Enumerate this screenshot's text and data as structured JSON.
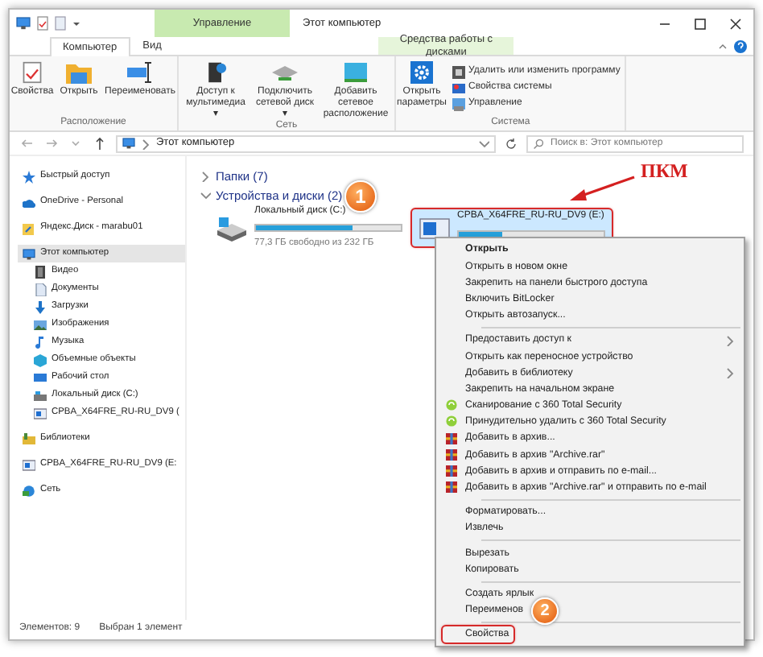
{
  "window": {
    "title": "Этот компьютер",
    "context_tab_header": "Управление"
  },
  "ribbon_tabs": [
    {
      "label": "Компьютер",
      "selected": true,
      "kind": "normal"
    },
    {
      "label": "Вид",
      "selected": false,
      "kind": "normal"
    },
    {
      "label": "Средства работы с дисками",
      "selected": false,
      "kind": "context"
    }
  ],
  "ribbon_groups": [
    {
      "label": "Расположение",
      "buttons": [
        {
          "label": "Свойства"
        },
        {
          "label": "Открыть"
        },
        {
          "label": "Переименовать"
        }
      ]
    },
    {
      "label": "Сеть",
      "buttons": [
        {
          "label": "Доступ к мультимедиа ▾"
        },
        {
          "label": "Подключить сетевой диск ▾"
        },
        {
          "label": "Добавить сетевое расположение"
        }
      ]
    },
    {
      "label": "Система",
      "buttons": [
        {
          "label": "Открыть параметры"
        }
      ],
      "small_buttons": [
        {
          "label": "Удалить или изменить программу"
        },
        {
          "label": "Свойства системы"
        },
        {
          "label": "Управление"
        }
      ]
    }
  ],
  "address_bar": {
    "path": "Этот компьютер",
    "search_placeholder": "Поиск в: Этот компьютер"
  },
  "sidebar": {
    "items": [
      {
        "label": "Быстрый доступ",
        "selected": false
      },
      {
        "label": "OneDrive - Personal",
        "selected": false
      },
      {
        "label": "Яндекс.Диск - marabu01",
        "selected": false
      },
      {
        "label": "Этот компьютер",
        "selected": true,
        "children": [
          {
            "label": "Видео",
            "selected": false
          },
          {
            "label": "Документы",
            "selected": false
          },
          {
            "label": "Загрузки",
            "selected": false
          },
          {
            "label": "Изображения",
            "selected": false
          },
          {
            "label": "Музыка",
            "selected": false
          },
          {
            "label": "Объемные объекты",
            "selected": false
          },
          {
            "label": "Рабочий стол",
            "selected": false
          },
          {
            "label": "Локальный диск (C:)",
            "selected": false
          },
          {
            "label": "CPBA_X64FRE_RU-RU_DV9 (",
            "selected": false
          }
        ]
      },
      {
        "label": "Библиотеки",
        "selected": false
      },
      {
        "label": "CPBA_X64FRE_RU-RU_DV9 (E:",
        "selected": false
      },
      {
        "label": "Сеть",
        "selected": false
      }
    ]
  },
  "content": {
    "groups": [
      {
        "label": "Папки (7)",
        "expanded": false
      },
      {
        "label": "Устройства и диски (2)",
        "expanded": true
      }
    ],
    "drives": [
      {
        "name": "Локальный диск (C:)",
        "free": "77,3 ГБ свободно из 232 ГБ",
        "level": 0.67,
        "selected": false,
        "marked": false
      },
      {
        "name": "CPBA_X64FRE_RU-RU_DV9 (E:)",
        "level": 0.3,
        "selected": true,
        "marked": true
      }
    ]
  },
  "context_menu": {
    "groups": [
      [
        {
          "label": "Открыть",
          "kind": "default"
        },
        {
          "label": "Открыть в новом окне",
          "kind": "plain"
        },
        {
          "label": "Закрепить на панели быстрого доступа",
          "kind": "plain"
        },
        {
          "label": "Включить BitLocker",
          "kind": "plain"
        },
        {
          "label": "Открыть автозапуск...",
          "kind": "plain"
        }
      ],
      [
        {
          "label": "Предоставить доступ к",
          "kind": "submenu"
        },
        {
          "label": "Открыть как переносное устройство",
          "kind": "plain"
        },
        {
          "label": "Добавить в библиотеку",
          "kind": "submenu"
        },
        {
          "label": "Закрепить на начальном экране",
          "kind": "plain"
        },
        {
          "label": "Сканирование с 360 Total Security",
          "kind": "antivirus"
        },
        {
          "label": "Принудительно удалить с  360 Total Security",
          "kind": "antivirus"
        },
        {
          "label": "Добавить в архив...",
          "kind": "archive"
        },
        {
          "label": "Добавить в архив \"Archive.rar\"",
          "kind": "archive"
        },
        {
          "label": "Добавить в архив и отправить по e-mail...",
          "kind": "archive"
        },
        {
          "label": "Добавить в архив \"Archive.rar\" и отправить по e-mail",
          "kind": "archive"
        }
      ],
      [
        {
          "label": "Форматировать...",
          "kind": "plain"
        },
        {
          "label": "Извлечь",
          "kind": "plain"
        }
      ],
      [
        {
          "label": "Вырезать",
          "kind": "plain"
        },
        {
          "label": "Копировать",
          "kind": "plain"
        }
      ],
      [
        {
          "label": "Создать ярлык",
          "kind": "plain"
        },
        {
          "label": "Переименов",
          "kind": "plain"
        }
      ],
      [
        {
          "label": "Свойства",
          "kind": "plain",
          "marked": true
        }
      ]
    ]
  },
  "annotations": {
    "callout": "ПКМ",
    "badges": [
      "1",
      "2"
    ]
  },
  "status_bar": {
    "count": "Элементов: 9",
    "selection": "Выбран 1 элемент"
  }
}
